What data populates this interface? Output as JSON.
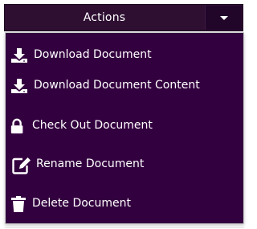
{
  "actions_button": {
    "label": "Actions",
    "caret_icon": "caret-down-icon"
  },
  "menu": {
    "items": [
      {
        "label": "Download Document",
        "icon": "download-icon"
      },
      {
        "label": "Download Document Content",
        "icon": "download-icon"
      },
      {
        "label": "Check Out Document",
        "icon": "lock-icon"
      },
      {
        "label": "Rename Document",
        "icon": "edit-icon"
      },
      {
        "label": "Delete Document",
        "icon": "trash-icon"
      }
    ]
  },
  "colors": {
    "button_bg": "#2e0f32",
    "menu_bg": "#33003f",
    "text": "#ffffff"
  }
}
